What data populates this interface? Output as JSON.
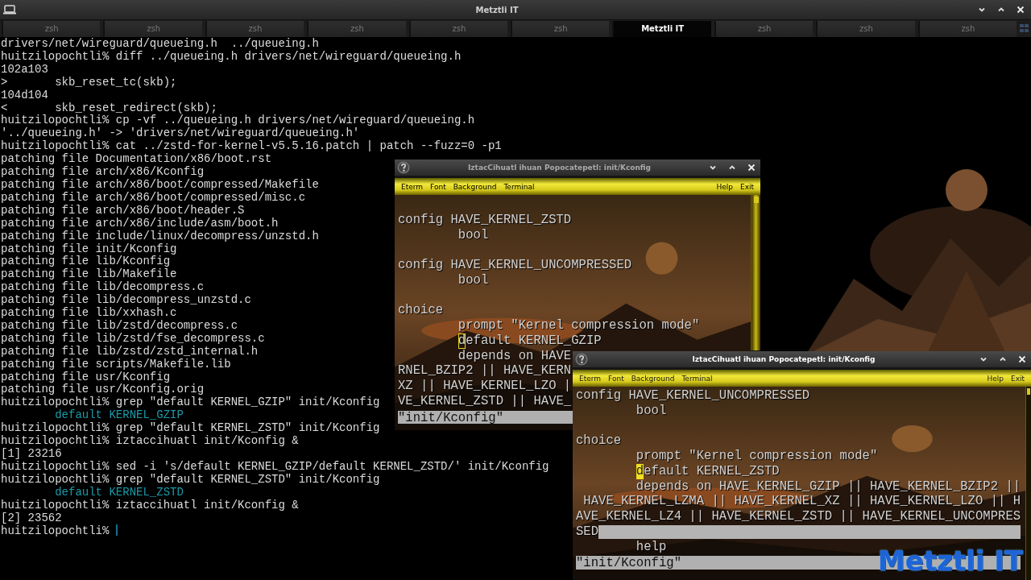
{
  "window": {
    "title": "Metztli IT"
  },
  "tabs": [
    {
      "label": "zsh",
      "selected": false
    },
    {
      "label": "zsh",
      "selected": false
    },
    {
      "label": "zsh",
      "selected": false
    },
    {
      "label": "zsh",
      "selected": false
    },
    {
      "label": "zsh",
      "selected": false
    },
    {
      "label": "zsh",
      "selected": false
    },
    {
      "label": "Metztli IT",
      "selected": true
    },
    {
      "label": "zsh",
      "selected": false
    },
    {
      "label": "zsh",
      "selected": false
    },
    {
      "label": "zsh",
      "selected": false
    }
  ],
  "terminal": {
    "lines": [
      {
        "kind": "output",
        "text": "drivers/net/wireguard/queueing.h  ../queueing.h"
      },
      {
        "kind": "output",
        "text": "huitzilopochtli% diff ../queueing.h drivers/net/wireguard/queueing.h"
      },
      {
        "kind": "output",
        "text": "102a103"
      },
      {
        "kind": "output",
        "text": ">       skb_reset_tc(skb);"
      },
      {
        "kind": "output",
        "text": "104d104"
      },
      {
        "kind": "output",
        "text": "<       skb_reset_redirect(skb);"
      },
      {
        "kind": "output",
        "text": "huitzilopochtli% cp -vf ../queueing.h drivers/net/wireguard/queueing.h"
      },
      {
        "kind": "output",
        "text": "'../queueing.h' -> 'drivers/net/wireguard/queueing.h'"
      },
      {
        "kind": "output",
        "text": "huitzilopochtli% cat ../zstd-for-kernel-v5.5.16.patch | patch --fuzz=0 -p1"
      },
      {
        "kind": "output",
        "text": "patching file Documentation/x86/boot.rst"
      },
      {
        "kind": "output",
        "text": "patching file arch/x86/Kconfig"
      },
      {
        "kind": "output",
        "text": "patching file arch/x86/boot/compressed/Makefile"
      },
      {
        "kind": "output",
        "text": "patching file arch/x86/boot/compressed/misc.c"
      },
      {
        "kind": "output",
        "text": "patching file arch/x86/boot/header.S"
      },
      {
        "kind": "output",
        "text": "patching file arch/x86/include/asm/boot.h"
      },
      {
        "kind": "output",
        "text": "patching file include/linux/decompress/unzstd.h"
      },
      {
        "kind": "output",
        "text": "patching file init/Kconfig"
      },
      {
        "kind": "output",
        "text": "patching file lib/Kconfig"
      },
      {
        "kind": "output",
        "text": "patching file lib/Makefile"
      },
      {
        "kind": "output",
        "text": "patching file lib/decompress.c"
      },
      {
        "kind": "output",
        "text": "patching file lib/decompress_unzstd.c"
      },
      {
        "kind": "output",
        "text": "patching file lib/xxhash.c"
      },
      {
        "kind": "output",
        "text": "patching file lib/zstd/decompress.c"
      },
      {
        "kind": "output",
        "text": "patching file lib/zstd/fse_decompress.c"
      },
      {
        "kind": "output",
        "text": "patching file lib/zstd/zstd_internal.h"
      },
      {
        "kind": "output",
        "text": "patching file scripts/Makefile.lib"
      },
      {
        "kind": "output",
        "text": "patching file usr/Kconfig"
      },
      {
        "kind": "output",
        "text": "patching file usr/Kconfig.orig"
      },
      {
        "kind": "output",
        "text": "huitzilopochtli% grep \"default KERNEL_GZIP\" init/Kconfig"
      },
      {
        "kind": "match",
        "text": "        default KERNEL_GZIP"
      },
      {
        "kind": "output",
        "text": "huitzilopochtli% grep \"default KERNEL_ZSTD\" init/Kconfig"
      },
      {
        "kind": "output",
        "text": "huitzilopochtli% iztaccihuatl init/Kconfig &"
      },
      {
        "kind": "output",
        "text": "[1] 23216"
      },
      {
        "kind": "output",
        "text": "huitzilopochtli% sed -i 's/default KERNEL_GZIP/default KERNEL_ZSTD/' init/Kconfig"
      },
      {
        "kind": "output",
        "text": "huitzilopochtli% grep \"default KERNEL_ZSTD\" init/Kconfig"
      },
      {
        "kind": "match",
        "text": "        default KERNEL_ZSTD"
      },
      {
        "kind": "output",
        "text": "huitzilopochtli% iztaccihuatl init/Kconfig &"
      },
      {
        "kind": "output",
        "text": "[2] 23562"
      },
      {
        "kind": "prompt",
        "text": "huitzilopochtli% "
      }
    ]
  },
  "eterm_windows": [
    {
      "title": "IztacCihuatl ihuan Popocatepetl: init/Kconfig",
      "focused": false,
      "menu": [
        "Eterm",
        "Font",
        "Background",
        "Terminal"
      ],
      "menu_right": [
        "Help",
        "Exit"
      ],
      "lines": [
        {
          "kind": "blank"
        },
        {
          "kind": "text",
          "text": "config HAVE_KERNEL_ZSTD"
        },
        {
          "kind": "text",
          "text": "        bool"
        },
        {
          "kind": "blank"
        },
        {
          "kind": "text",
          "text": "config HAVE_KERNEL_UNCOMPRESSED"
        },
        {
          "kind": "text",
          "text": "        bool"
        },
        {
          "kind": "blank"
        },
        {
          "kind": "text",
          "text": "choice"
        },
        {
          "kind": "text",
          "text": "        prompt \"Kernel compression mode\""
        },
        {
          "kind": "cursor",
          "indented": true,
          "cursor": "d",
          "text": "efault KERNEL_GZIP"
        },
        {
          "kind": "text",
          "text": "        depends on HAVE"
        },
        {
          "kind": "text",
          "text": "RNEL_BZIP2 || HAVE_KERN"
        },
        {
          "kind": "text",
          "text": "XZ || HAVE_KERNEL_LZO |"
        },
        {
          "kind": "text",
          "text": "VE_KERNEL_ZSTD || HAVE_"
        },
        {
          "kind": "status",
          "text": "\"init/Kconfig\""
        }
      ]
    },
    {
      "title": "IztacCihuatl ihuan Popocatepetl: init/Kconfig",
      "focused": true,
      "menu": [
        "Eterm",
        "Font",
        "Background",
        "Terminal"
      ],
      "menu_right": [
        "Help",
        "Exit"
      ],
      "lines": [
        {
          "kind": "text",
          "text": "config HAVE_KERNEL_UNCOMPRESSED"
        },
        {
          "kind": "text",
          "text": "        bool"
        },
        {
          "kind": "blank"
        },
        {
          "kind": "text",
          "text": "choice"
        },
        {
          "kind": "text",
          "text": "        prompt \"Kernel compression mode\""
        },
        {
          "kind": "cursor",
          "indented": true,
          "cursor": "d",
          "text": "efault KERNEL_ZSTD"
        },
        {
          "kind": "text",
          "text": "        depends on HAVE_KERNEL_GZIP || HAVE_KERNEL_BZIP2 ||"
        },
        {
          "kind": "text",
          "text": " HAVE_KERNEL_LZMA || HAVE_KERNEL_XZ || HAVE_KERNEL_LZO || H"
        },
        {
          "kind": "text",
          "text": "AVE_KERNEL_LZ4 || HAVE_KERNEL_ZSTD || HAVE_KERNEL_UNCOMPRES"
        },
        {
          "kind": "highlight",
          "text": "SED"
        },
        {
          "kind": "text",
          "text": "        help"
        },
        {
          "kind": "status",
          "text": "\"init/Kconfig\""
        }
      ]
    }
  ],
  "logo": {
    "text": "Metztli IT"
  }
}
